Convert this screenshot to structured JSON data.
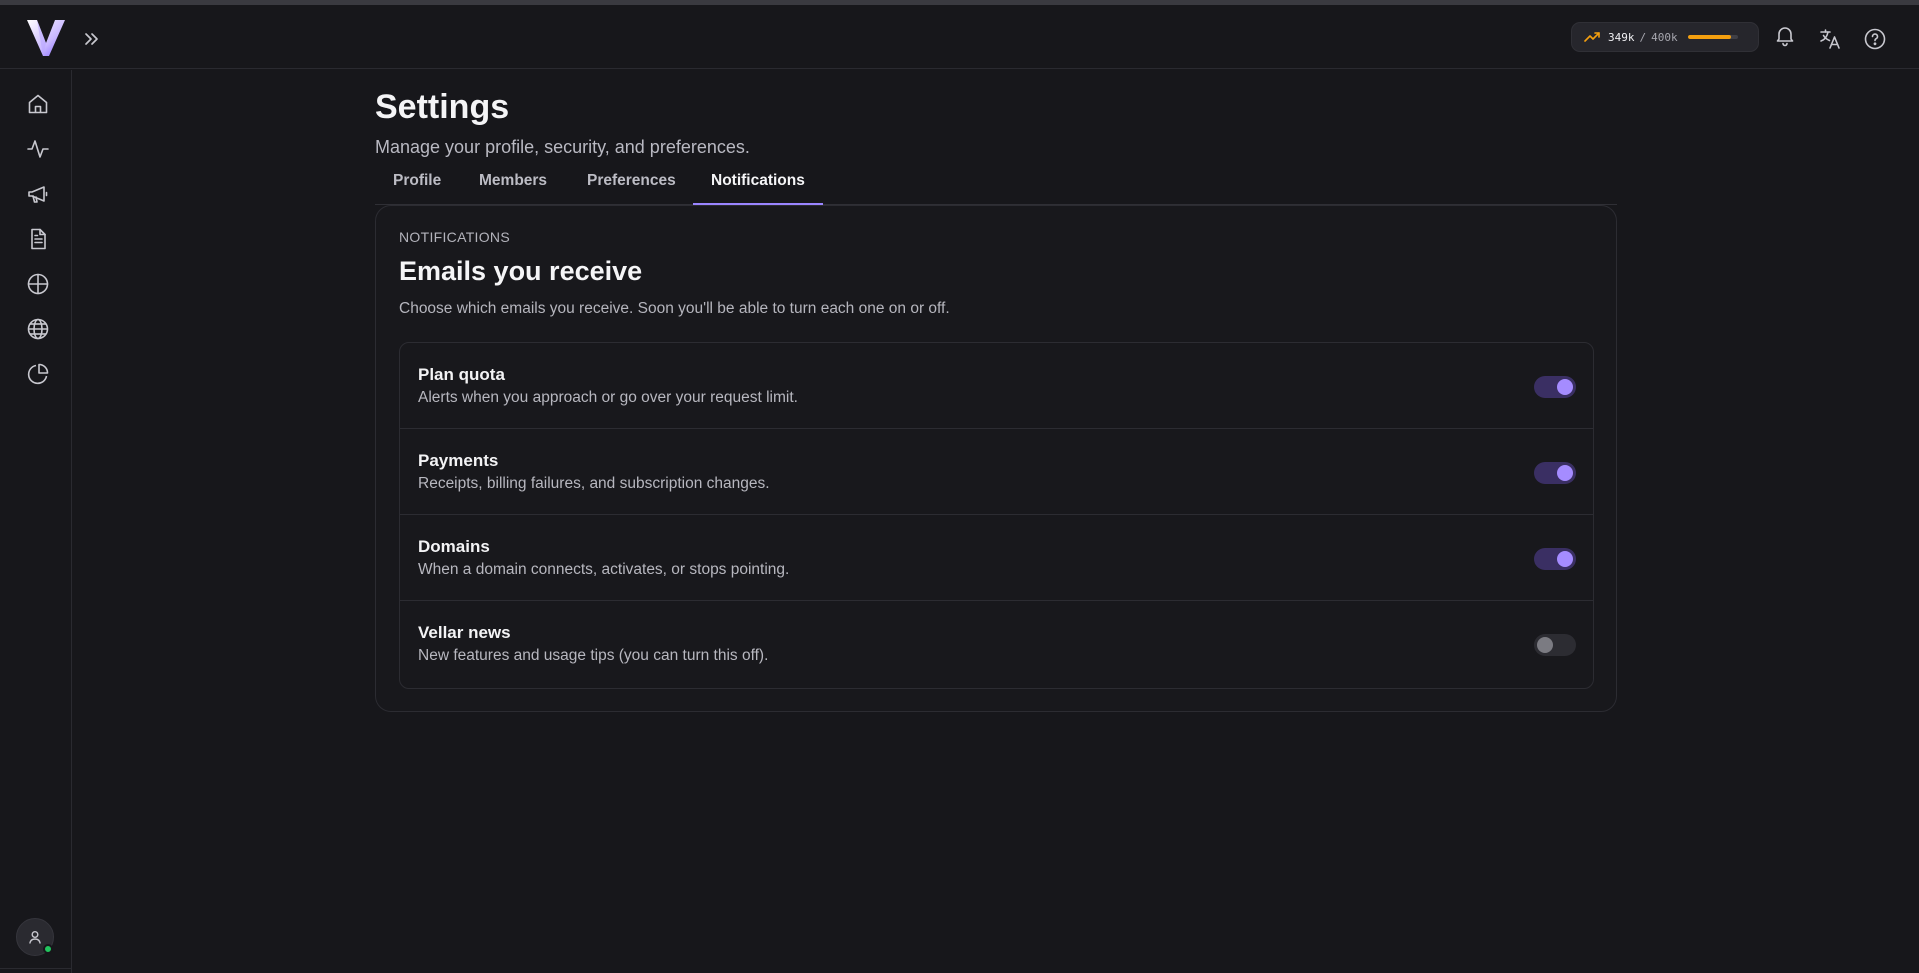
{
  "app": {
    "logo_icon": "vellar-v-logo",
    "expand_icon": "double-chevron-right-icon"
  },
  "header": {
    "usage": {
      "used": "349k",
      "separator": "/",
      "limit": "400k",
      "fraction": 0.8725,
      "color": "#f5a00f",
      "icon": "trend-up-icon"
    },
    "icons": [
      "bell-icon",
      "translate-icon",
      "help-icon"
    ]
  },
  "sidebar": {
    "items": [
      "home-icon",
      "activity-icon",
      "megaphone-icon",
      "document-icon",
      "crosshair-icon",
      "globe-icon",
      "pie-chart-icon"
    ],
    "avatar_icon": "user-icon",
    "status_color": "#22c55e"
  },
  "page": {
    "title": "Settings",
    "subtitle": "Manage your profile, security, and preferences."
  },
  "tabs": [
    {
      "label": "Profile",
      "active": false
    },
    {
      "label": "Members",
      "active": false
    },
    {
      "label": "Preferences",
      "active": false
    },
    {
      "label": "Notifications",
      "active": true
    }
  ],
  "notifications": {
    "eyebrow": "NOTIFICATIONS",
    "title": "Emails you receive",
    "description": "Choose which emails you receive. Soon you'll be able to turn each one on or off.",
    "items": [
      {
        "title": "Plan quota",
        "description": "Alerts when you approach or go over your request limit.",
        "enabled": true
      },
      {
        "title": "Payments",
        "description": "Receipts, billing failures, and subscription changes.",
        "enabled": true
      },
      {
        "title": "Domains",
        "description": "When a domain connects, activates, or stops pointing.",
        "enabled": true
      },
      {
        "title": "Vellar news",
        "description": "New features and usage tips (you can turn this off).",
        "enabled": false
      }
    ]
  },
  "colors": {
    "accent": "#a58cff",
    "toggle_on_track": "#3a2f63",
    "background": "#17171b"
  }
}
